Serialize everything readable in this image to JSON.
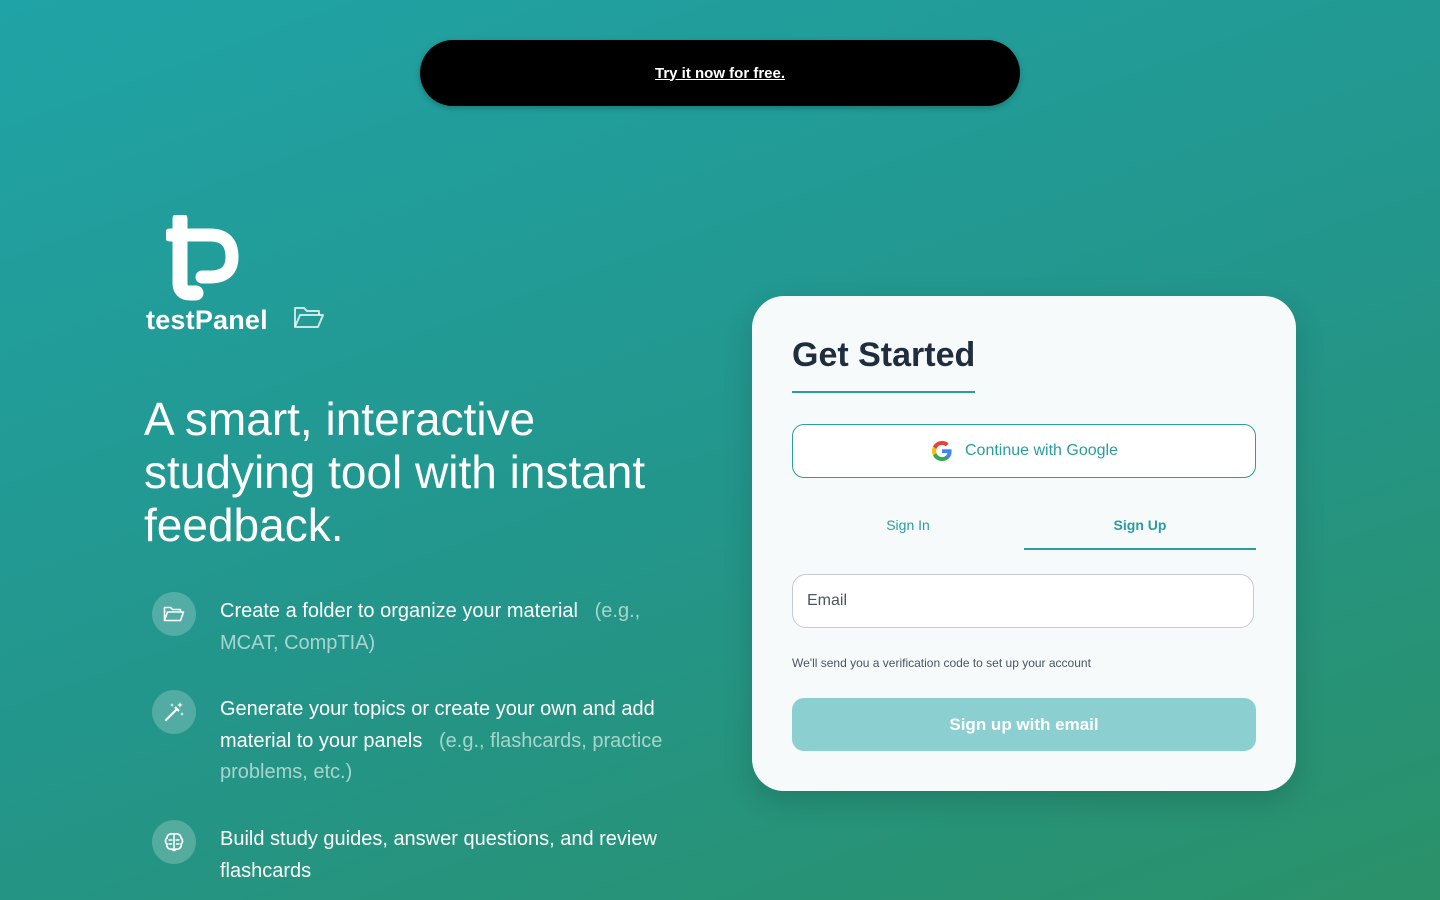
{
  "promo": {
    "link_text": "Try it now for free."
  },
  "brand": {
    "name": "testPanel"
  },
  "headline": "A smart, interactive studying tool with instant feedback.",
  "features": [
    {
      "icon": "folder-open-icon",
      "text": "Create a folder to organize your material",
      "example": "(e.g., MCAT, CompTIA)"
    },
    {
      "icon": "magic-wand-icon",
      "text": "Generate your topics or create your own and add material to your panels",
      "example": "(e.g., flashcards, practice problems, etc.)"
    },
    {
      "icon": "brain-icon",
      "text": "Build study guides, answer questions, and review flashcards",
      "example": ""
    }
  ],
  "auth": {
    "title": "Get Started",
    "google_label": "Continue with Google",
    "tabs": [
      {
        "label": "Sign In",
        "active": false
      },
      {
        "label": "Sign Up",
        "active": true
      }
    ],
    "email_placeholder": "Email",
    "email_value": "",
    "helper": "We'll send you a verification code to set up your account",
    "submit_label": "Sign up with email"
  },
  "colors": {
    "accent": "#2a9d9f",
    "headline_dark": "#1f2d3f",
    "submit_disabled": "#8ccfd0",
    "promo_bg": "#000000"
  }
}
